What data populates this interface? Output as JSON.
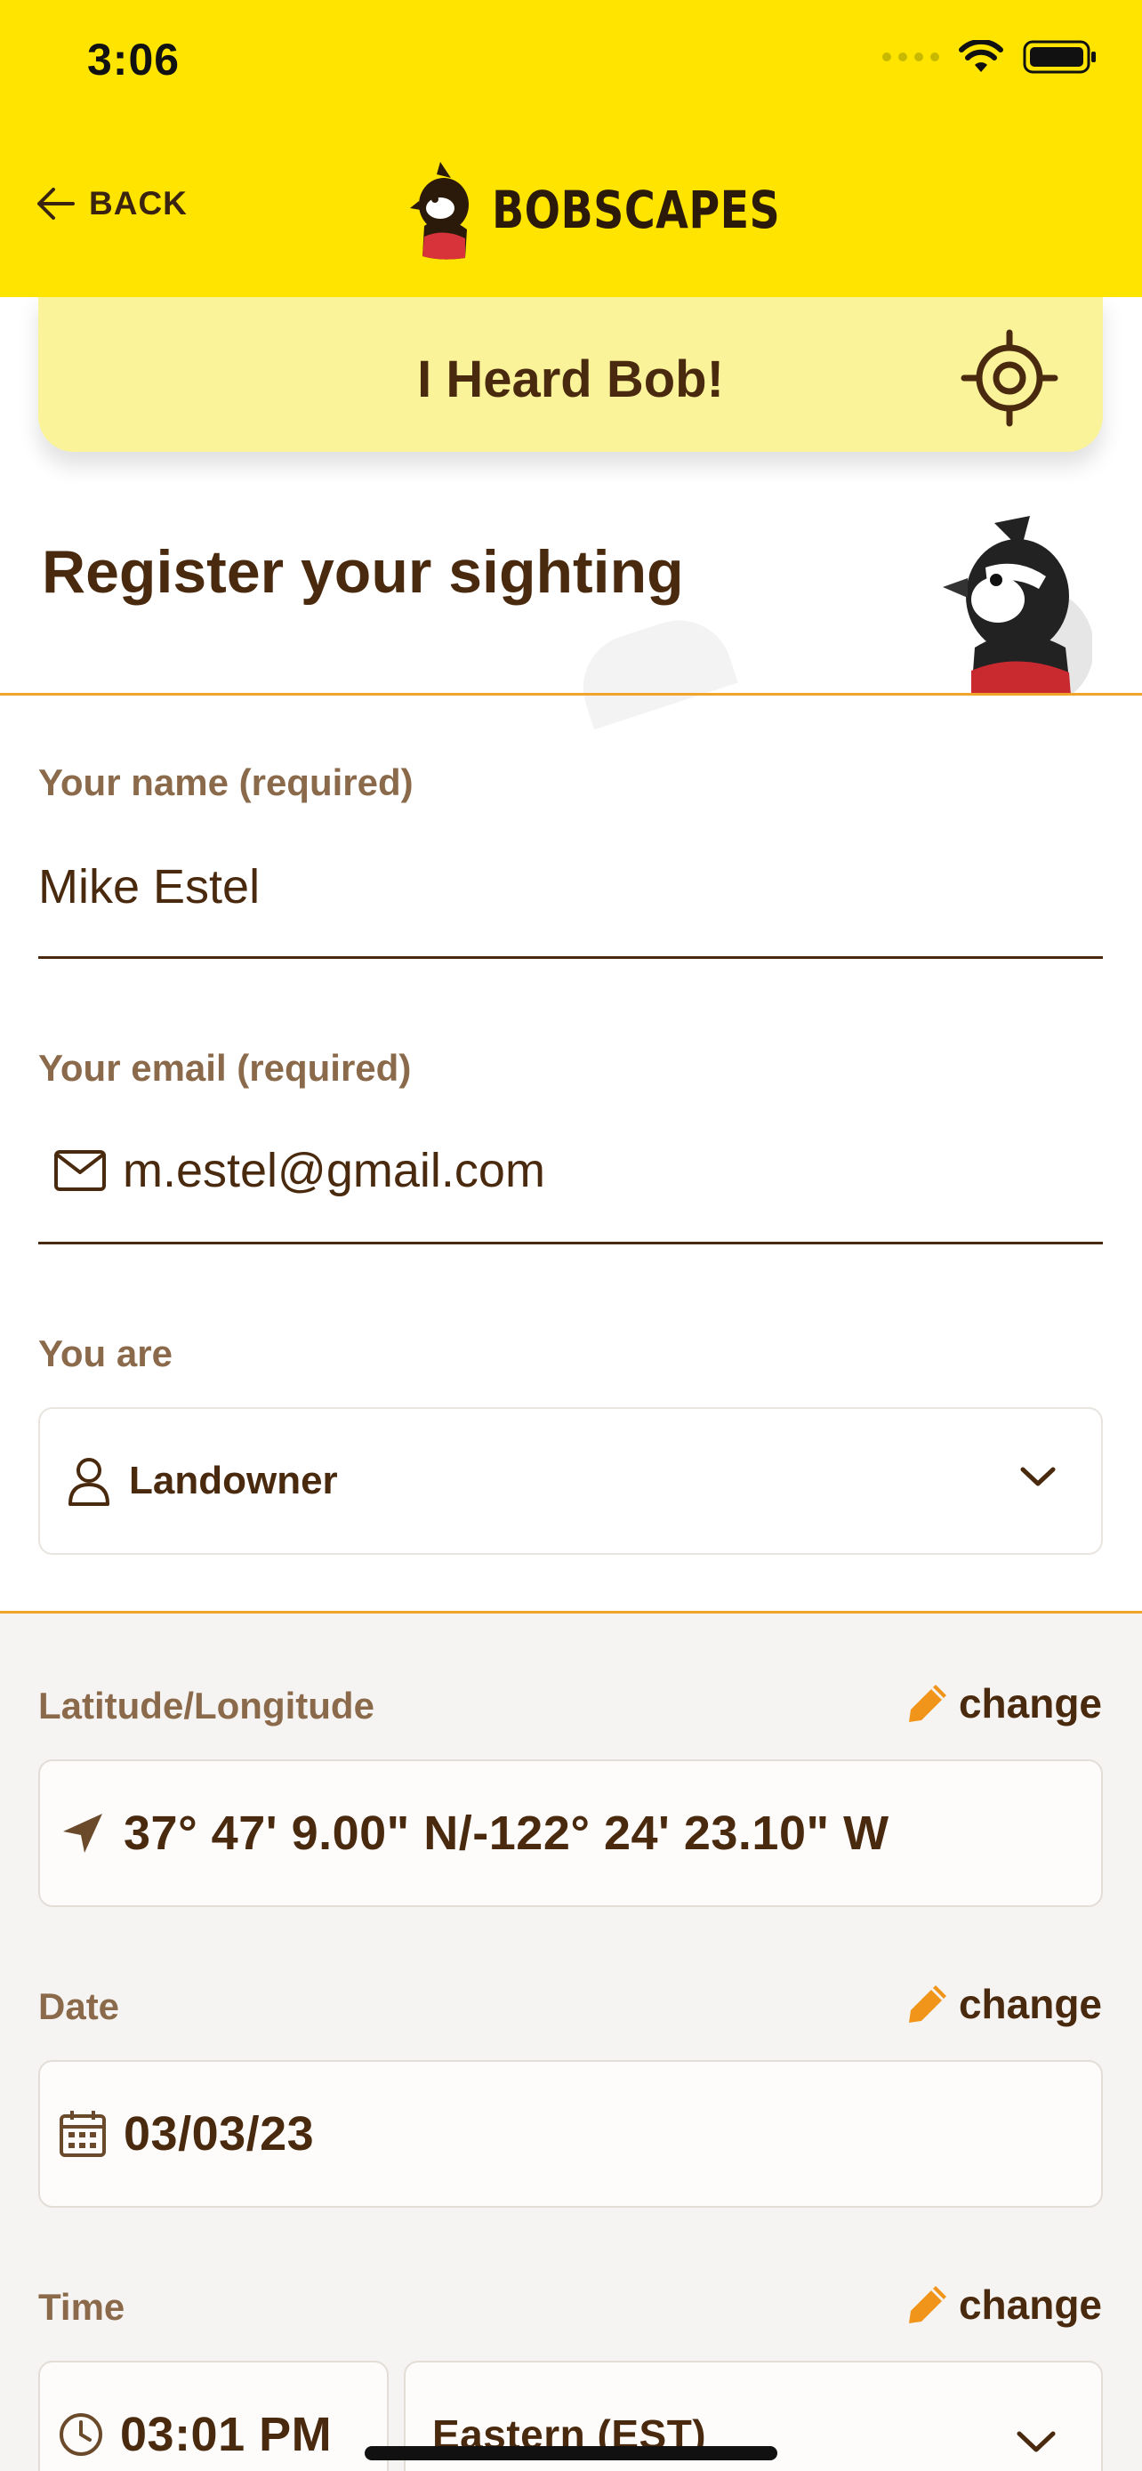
{
  "status_bar": {
    "time": "3:06"
  },
  "header": {
    "back_label": "BACK",
    "brand": "BOBSCAPES"
  },
  "heard_bar": {
    "label": "I Heard Bob!"
  },
  "register": {
    "title": "Register your sighting"
  },
  "form": {
    "name": {
      "label": "Your name (required)",
      "value": "Mike Estel"
    },
    "email": {
      "label": "Your email (required)",
      "value": "m.estel@gmail.com"
    },
    "role": {
      "label": "You are",
      "value": "Landowner"
    }
  },
  "location": {
    "label": "Latitude/Longitude",
    "change_label": "change",
    "value": "37° 47' 9.00\"  N/-122° 24' 23.10\"  W"
  },
  "date": {
    "label": "Date",
    "change_label": "change",
    "value": "03/03/23"
  },
  "time": {
    "label": "Time",
    "change_label": "change",
    "value": "03:01 PM",
    "timezone": "Eastern (EST)"
  },
  "colors": {
    "header_yellow": "#ffe400",
    "heard_bar": "#fbf39a",
    "accent_orange": "#f0a52a",
    "text_brown": "#4a2a0e",
    "label_brown": "#8a6a4a"
  }
}
